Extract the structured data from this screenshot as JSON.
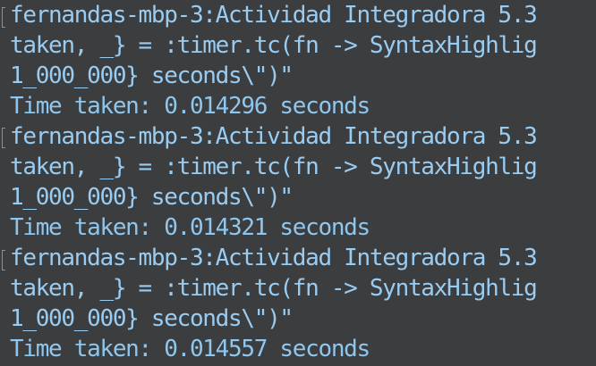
{
  "terminal": {
    "colors": {
      "background": "#3c3d3f",
      "text": "#99ccf2",
      "mark": "#8e8f92"
    },
    "blocks": [
      {
        "prompt": "fernandas-mbp-3:Actividad Integradora 5.3",
        "command_line_2": "taken, _} = :timer.tc(fn -> SyntaxHighlig",
        "command_line_3": "1_000_000} seconds\\\")\"",
        "output": "Time taken: 0.014296 seconds"
      },
      {
        "prompt": "fernandas-mbp-3:Actividad Integradora 5.3",
        "command_line_2": "taken, _} = :timer.tc(fn -> SyntaxHighlig",
        "command_line_3": "1_000_000} seconds\\\")\"",
        "output": "Time taken: 0.014321 seconds"
      },
      {
        "prompt": "fernandas-mbp-3:Actividad Integradora 5.3",
        "command_line_2": "taken, _} = :timer.tc(fn -> SyntaxHighlig",
        "command_line_3": "1_000_000} seconds\\\")\"",
        "output": "Time taken: 0.014557 seconds"
      }
    ]
  }
}
